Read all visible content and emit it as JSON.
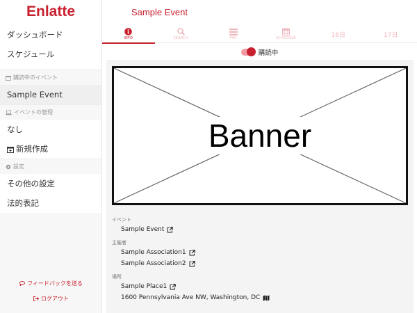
{
  "app": {
    "logo": "Enlatte"
  },
  "sidebar": {
    "dashboard": "ダッシュボード",
    "schedule": "スケジュール",
    "subscribed_section": "購読中のイベント",
    "subscribed_event": "Sample Event",
    "manage_section": "イベントの管理",
    "manage_none": "なし",
    "create_new": "新規作成",
    "settings_section": "設定",
    "other_settings": "その他の設定",
    "legal": "法的表記",
    "feedback": "フィードバックを送る",
    "logout": "ログアウト"
  },
  "header": {
    "title": "Sample Event"
  },
  "tabs": [
    {
      "label": "INFO",
      "icon": "info-icon",
      "active": true
    },
    {
      "label": "SEARCH",
      "icon": "search-icon",
      "active": false
    },
    {
      "label": "FAV",
      "icon": "list-icon",
      "active": false
    },
    {
      "label": "SCHEDULE",
      "icon": "calendar-icon",
      "active": false
    },
    {
      "label": "16日",
      "active": false
    },
    {
      "label": "17日",
      "active": false
    }
  ],
  "subscribe": {
    "label": "購読中",
    "on": true
  },
  "banner": {
    "text": "Banner"
  },
  "info": {
    "event_label": "イベント",
    "event_value": "Sample Event",
    "organizer_label": "主催者",
    "organizers": [
      "Sample Association1",
      "Sample Association2"
    ],
    "place_label": "場所",
    "place_name": "Sample Place1",
    "address": "1600 Pennsylvania Ave NW, Washington, DC"
  },
  "colors": {
    "accent": "#c8202f",
    "accent_light": "#f0b8be"
  }
}
